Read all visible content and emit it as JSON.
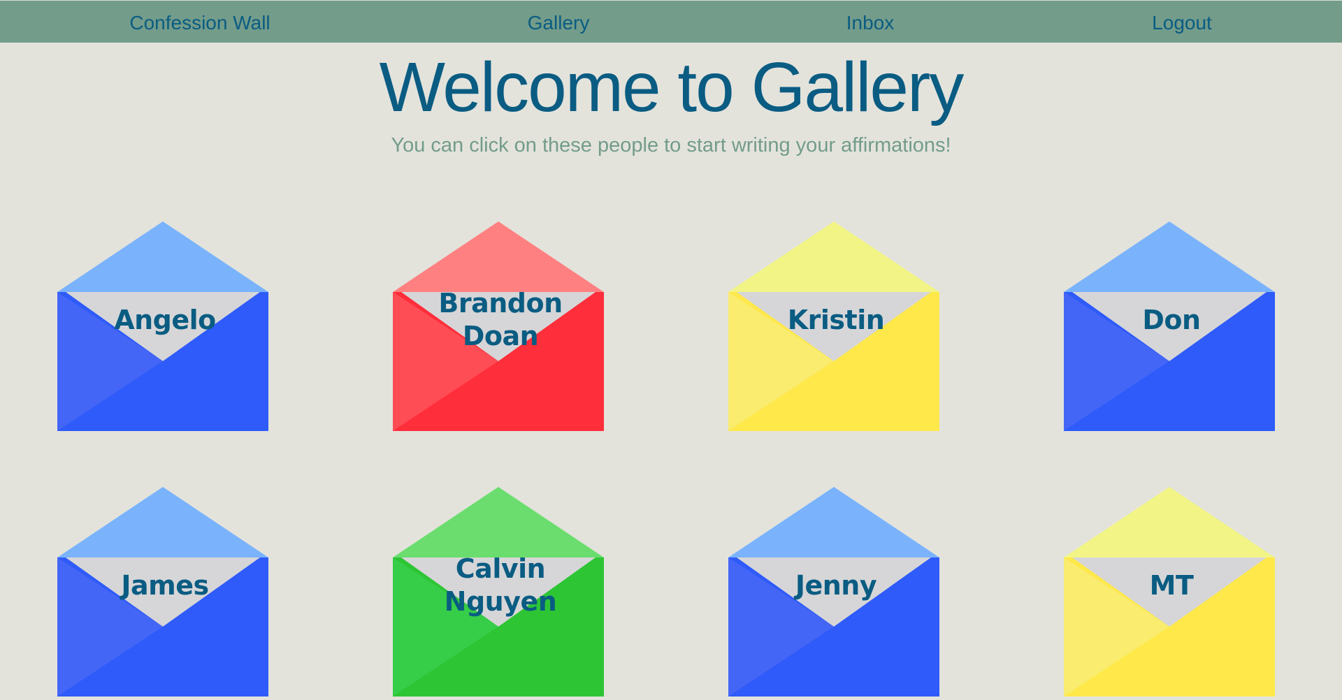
{
  "nav": {
    "items": [
      {
        "label": "Confession Wall"
      },
      {
        "label": "Gallery"
      },
      {
        "label": "Inbox"
      },
      {
        "label": "Logout"
      }
    ]
  },
  "header": {
    "title": "Welcome to Gallery",
    "subtitle": "You can click on these people to start writing your affirmations!"
  },
  "palette": {
    "nav_bg": "#739c8a",
    "page_bg": "#e3e3dc",
    "text_primary": "#0a5c82",
    "text_secondary": "#739c8a",
    "letter": "#d6d6d8"
  },
  "gallery": {
    "envelopes": [
      {
        "name": "Angelo",
        "color": "blue"
      },
      {
        "name": "Brandon Doan",
        "color": "red"
      },
      {
        "name": "Kristin",
        "color": "yellow"
      },
      {
        "name": "Don",
        "color": "blue"
      },
      {
        "name": "James",
        "color": "blue"
      },
      {
        "name": "Calvin Nguyen",
        "color": "green"
      },
      {
        "name": "Jenny",
        "color": "blue"
      },
      {
        "name": "MT",
        "color": "yellow"
      }
    ],
    "colors": {
      "blue": {
        "flap": "#7ab3fc",
        "left": "#4466f6",
        "right": "#2e5bf9",
        "bottom": "#2e5bf9"
      },
      "red": {
        "flap": "#ff8080",
        "left": "#ff4d55",
        "right": "#ff2e3b",
        "bottom": "#ff2e3b"
      },
      "yellow": {
        "flap": "#f2f586",
        "left": "#f9ec6e",
        "right": "#ffe84a",
        "bottom": "#ffe84a"
      },
      "green": {
        "flap": "#6add6e",
        "left": "#36cd48",
        "right": "#2ec535",
        "bottom": "#2ec535"
      }
    }
  }
}
